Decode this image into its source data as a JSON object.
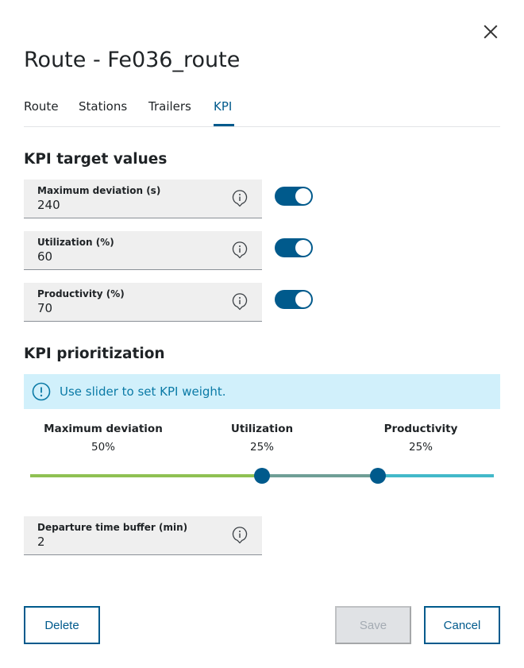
{
  "dialog": {
    "title": "Route - Fe036_route"
  },
  "tabs": [
    {
      "label": "Route",
      "active": false
    },
    {
      "label": "Stations",
      "active": false
    },
    {
      "label": "Trailers",
      "active": false
    },
    {
      "label": "KPI",
      "active": true
    }
  ],
  "kpi_targets": {
    "heading": "KPI target values",
    "fields": [
      {
        "label": "Maximum deviation (s)",
        "value": "240",
        "toggle_on": true
      },
      {
        "label": "Utilization (%)",
        "value": "60",
        "toggle_on": true
      },
      {
        "label": "Productivity (%)",
        "value": "70",
        "toggle_on": true
      }
    ]
  },
  "kpi_prioritization": {
    "heading": "KPI prioritization",
    "notice": "Use slider to set KPI weight.",
    "weights": [
      {
        "name": "Maximum deviation",
        "percent": "50%",
        "value": 50
      },
      {
        "name": "Utilization",
        "percent": "25%",
        "value": 25
      },
      {
        "name": "Productivity",
        "percent": "25%",
        "value": 25
      }
    ]
  },
  "departure_buffer": {
    "label": "Departure time buffer (min)",
    "value": "2"
  },
  "actions": {
    "delete_label": "Delete",
    "save_label": "Save",
    "save_enabled": false,
    "cancel_label": "Cancel"
  },
  "colors": {
    "primary": "#005a8c",
    "notice_bg": "#d1f0fb",
    "notice_text": "#0a7aa6",
    "slider_segment_1": "#8fc153",
    "slider_segment_2": "#6f9e96",
    "slider_segment_3": "#43b9c9"
  },
  "icons": {
    "close": "close-icon",
    "info": "info-icon",
    "notice": "info-circle-icon"
  }
}
